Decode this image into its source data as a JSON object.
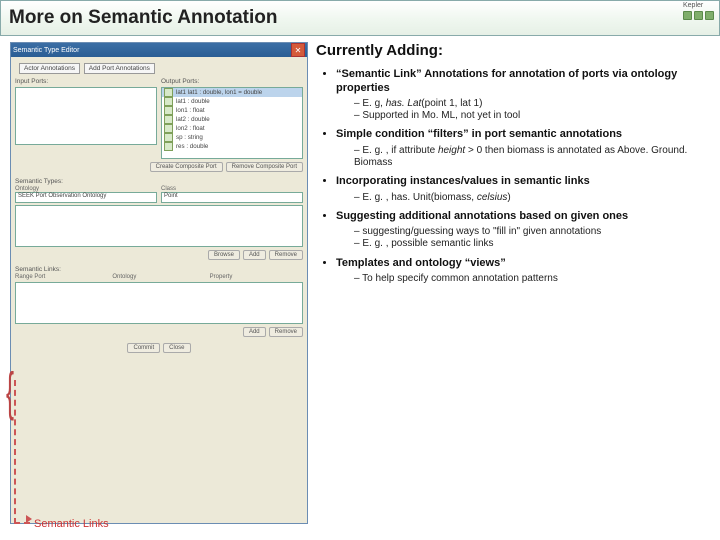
{
  "title": "More on Semantic Annotation",
  "logo_label": "Kepler",
  "editor": {
    "window_title": "Semantic Type Editor",
    "close_glyph": "✕",
    "tabs_label": "Actor Annotations",
    "tab2": "Add Port Annotations",
    "input_label": "Input Ports:",
    "output_label": "Output Ports:",
    "output_sel": "lat1   lat1 : double, lon1 = double",
    "rows": [
      "lat1 : double",
      "lon1 : float",
      "lat2 : double",
      "lon2 : float",
      "sp : string",
      "res : double"
    ],
    "btn_add_comp": "Create Composite Port",
    "btn_rem_comp": "Remove Composite Port",
    "sem_types": "Semantic Types:",
    "ontology_hdr": "Ontology",
    "class_hdr": "Class",
    "ontology_val": "SEEK Port Observation Ontology",
    "class_val": "Point",
    "btn_browse": "Browse",
    "btn_add": "Add",
    "btn_remove": "Remove",
    "sem_links": "Semantic Links:",
    "range_hdr": "Range Port",
    "ont_hdr2": "Ontology",
    "prop_hdr": "Property",
    "btn_add2": "Add",
    "btn_remove2": "Remove",
    "btn_commit": "Commit",
    "btn_close": "Close"
  },
  "content": {
    "heading": "Currently Adding:",
    "items": [
      {
        "main_pre": "“Semantic Link” Annotations for annotation of ports via ontology properties",
        "subs": [
          "E. g, has. Lat(point 1, lat 1)",
          "Supported in Mo. ML, not yet in tool"
        ]
      },
      {
        "main_pre": "Simple condition “filters” in port semantic annotations",
        "subs": [
          "E. g. , if attribute height > 0 then biomass is annotated as Above. Ground. Biomass"
        ]
      },
      {
        "main_pre": "Incorporating instances/values in semantic links",
        "subs": [
          "E. g. , has. Unit(biomass, celsius)"
        ]
      },
      {
        "main_pre": "Suggesting additional annotations based on given ones",
        "subs": [
          "suggesting/guessing ways to \"fill in\" given annotations",
          "E. g. , possible semantic links"
        ]
      },
      {
        "main_pre": "Templates and ontology “views”",
        "subs": [
          "To help specify common annotation patterns"
        ]
      }
    ]
  },
  "footnote": "Semantic Links"
}
